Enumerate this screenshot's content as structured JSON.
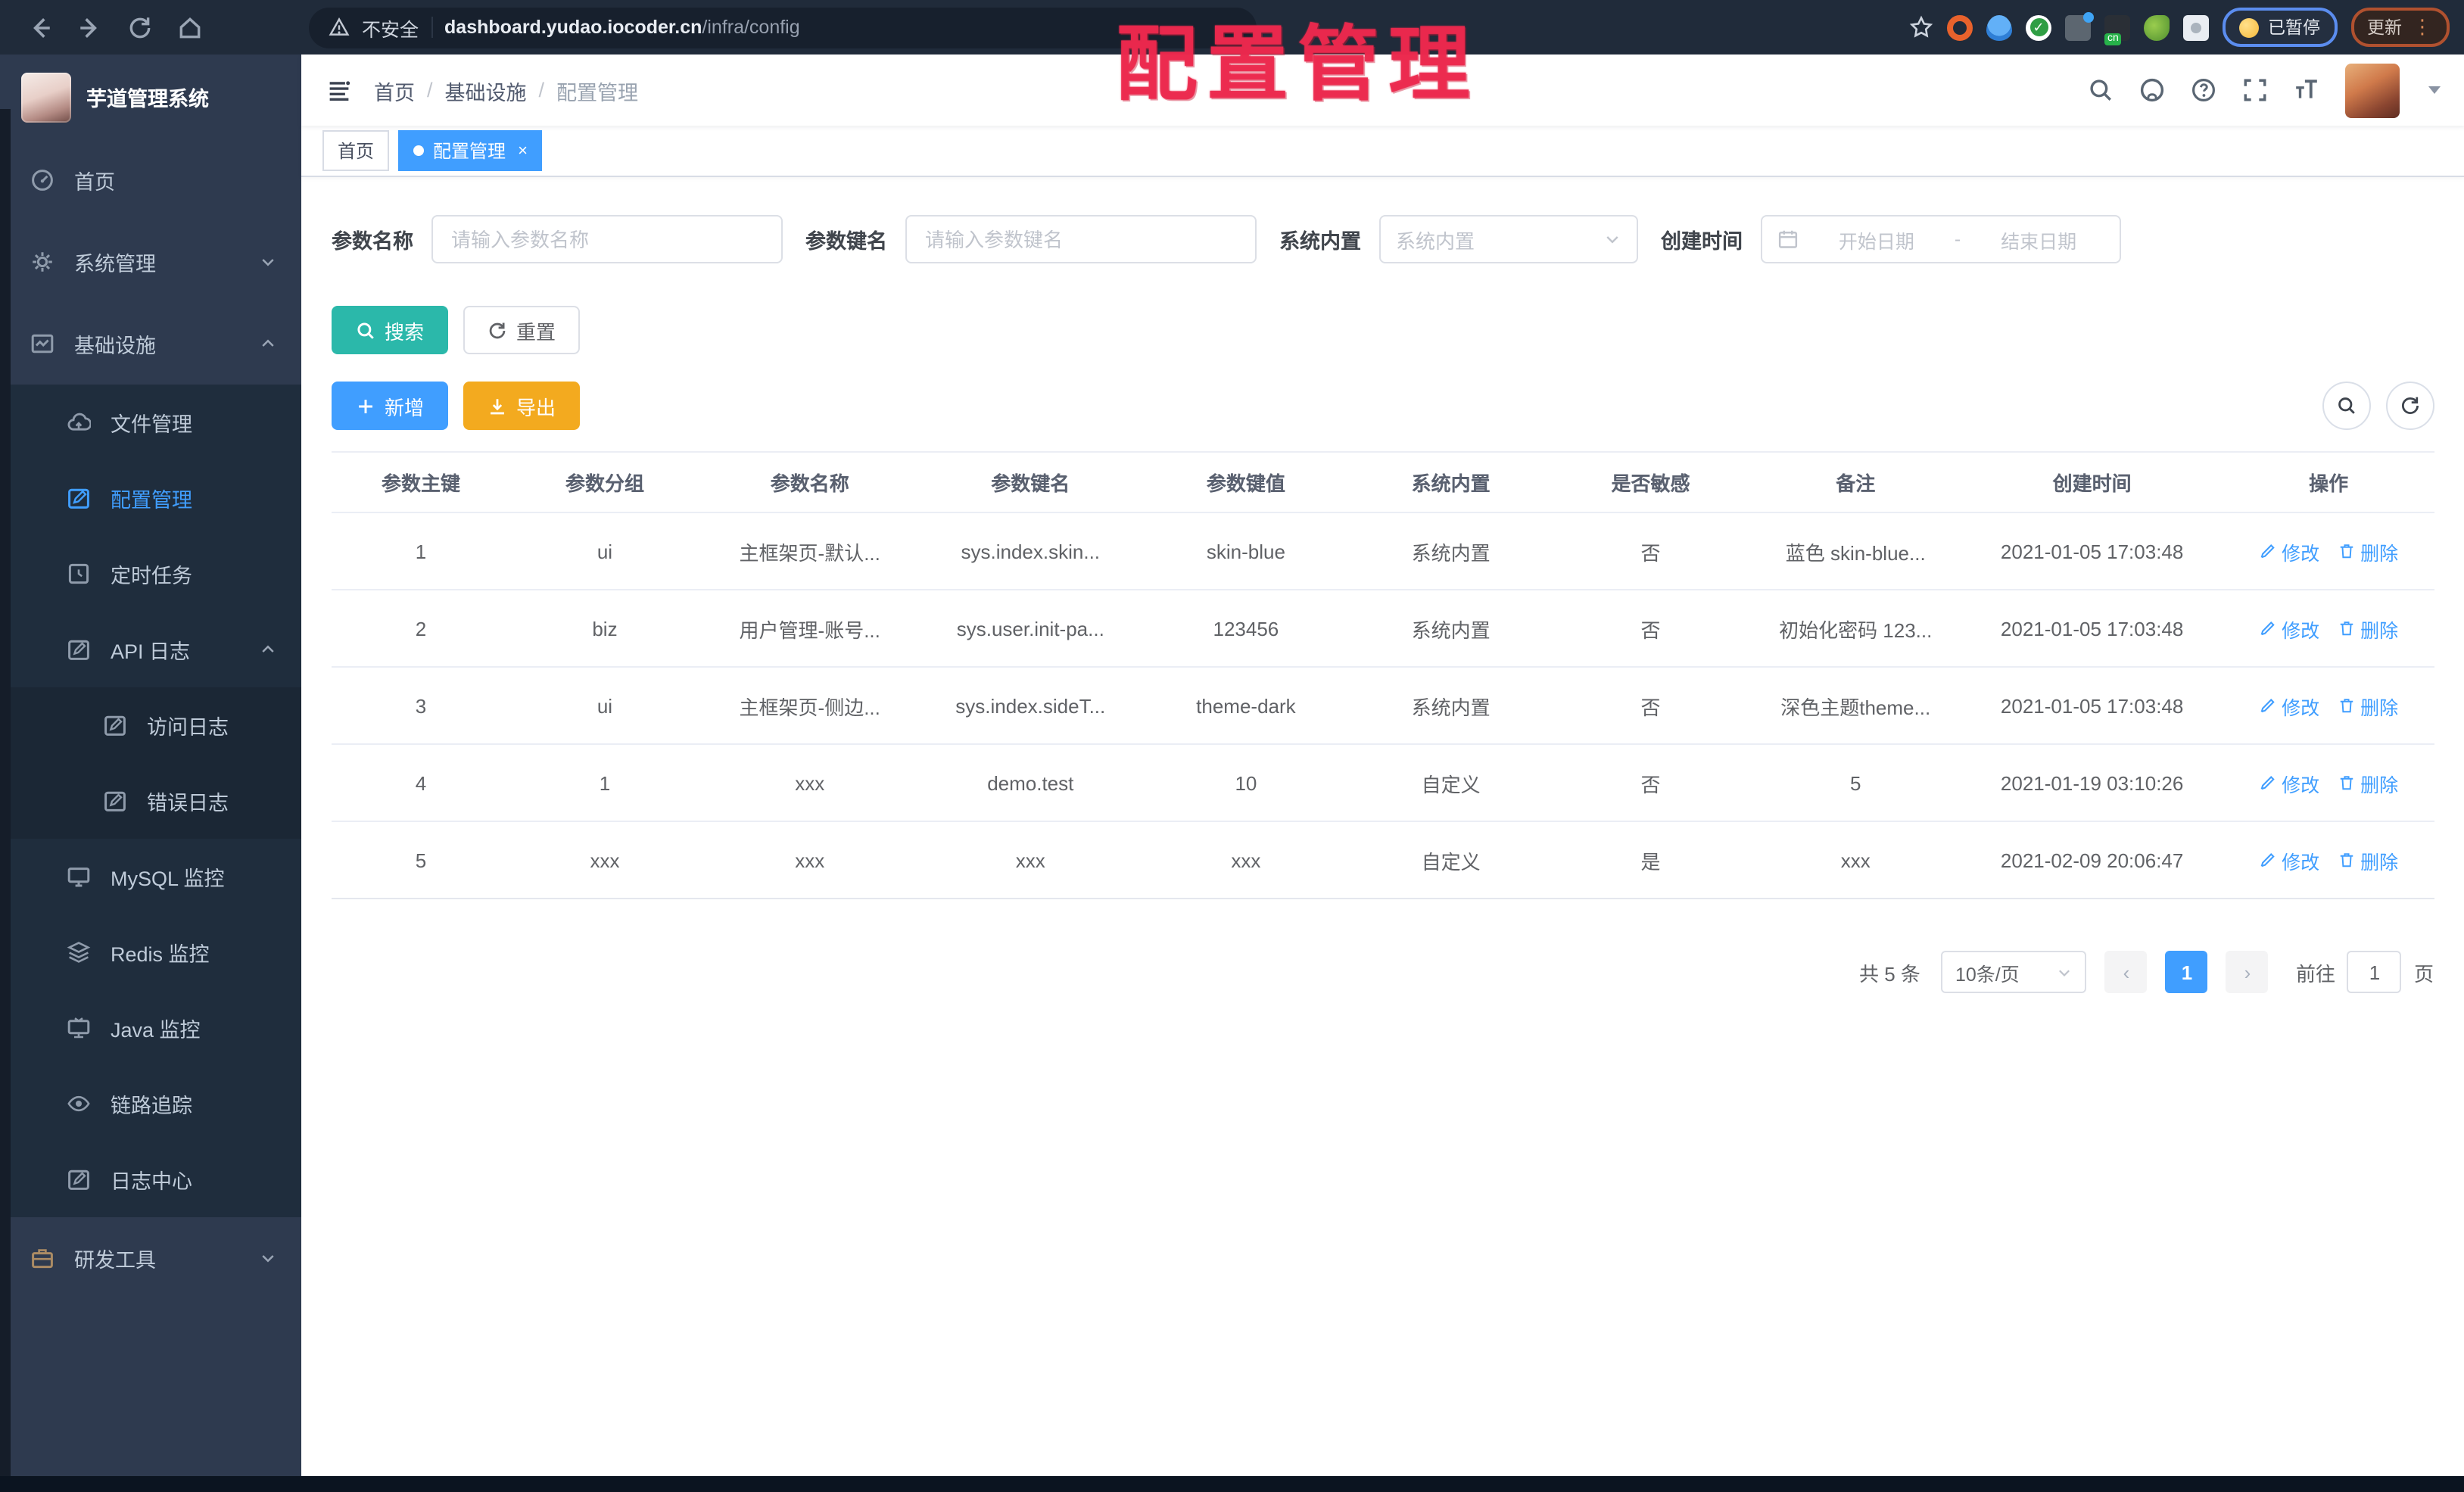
{
  "browser": {
    "security_label": "不安全",
    "url_host": "dashboard.yudao.iocoder.cn",
    "url_path": "/infra/config",
    "paused_badge": "已暂停",
    "update_button": "更新"
  },
  "watermark": "配置管理",
  "sidebar": {
    "title": "芋道管理系统",
    "items": [
      {
        "label": "首页",
        "icon": "dashboard",
        "level": 1
      },
      {
        "label": "系统管理",
        "icon": "gear",
        "level": 1,
        "arrow": "down"
      },
      {
        "label": "基础设施",
        "icon": "infra",
        "level": 1,
        "arrow": "up"
      },
      {
        "label": "文件管理",
        "icon": "cloud",
        "level": 2
      },
      {
        "label": "配置管理",
        "icon": "edit",
        "level": 2,
        "active": true
      },
      {
        "label": "定时任务",
        "icon": "timer",
        "level": 2
      },
      {
        "label": "API 日志",
        "icon": "log",
        "level": 2,
        "arrow": "up"
      },
      {
        "label": "访问日志",
        "icon": "log",
        "level": 3
      },
      {
        "label": "错误日志",
        "icon": "log",
        "level": 3
      },
      {
        "label": "MySQL 监控",
        "icon": "monitor",
        "level": 2
      },
      {
        "label": "Redis 监控",
        "icon": "layers",
        "level": 2
      },
      {
        "label": "Java 监控",
        "icon": "tv",
        "level": 2
      },
      {
        "label": "链路追踪",
        "icon": "eye",
        "level": 2
      },
      {
        "label": "日志中心",
        "icon": "log",
        "level": 2
      },
      {
        "label": "研发工具",
        "icon": "briefcase",
        "level": 1,
        "arrow": "down"
      }
    ]
  },
  "header": {
    "breadcrumb": [
      "首页",
      "基础设施",
      "配置管理"
    ]
  },
  "tabs": [
    {
      "label": "首页",
      "active": false
    },
    {
      "label": "配置管理",
      "active": true,
      "closable": true
    }
  ],
  "filters": {
    "name": {
      "label": "参数名称",
      "placeholder": "请输入参数名称"
    },
    "key": {
      "label": "参数键名",
      "placeholder": "请输入参数键名"
    },
    "builtin": {
      "label": "系统内置",
      "placeholder": "系统内置"
    },
    "time": {
      "label": "创建时间",
      "start": "开始日期",
      "separator": "-",
      "end": "结束日期"
    }
  },
  "buttons": {
    "search": "搜索",
    "reset": "重置",
    "add": "新增",
    "export": "导出"
  },
  "table": {
    "columns": [
      "参数主键",
      "参数分组",
      "参数名称",
      "参数键名",
      "参数键值",
      "系统内置",
      "是否敏感",
      "备注",
      "创建时间",
      "操作"
    ],
    "rows": [
      [
        "1",
        "ui",
        "主框架页-默认...",
        "sys.index.skin...",
        "skin-blue",
        "系统内置",
        "否",
        "蓝色 skin-blue...",
        "2021-01-05 17:03:48"
      ],
      [
        "2",
        "biz",
        "用户管理-账号...",
        "sys.user.init-pa...",
        "123456",
        "系统内置",
        "否",
        "初始化密码 123...",
        "2021-01-05 17:03:48"
      ],
      [
        "3",
        "ui",
        "主框架页-侧边...",
        "sys.index.sideT...",
        "theme-dark",
        "系统内置",
        "否",
        "深色主题theme...",
        "2021-01-05 17:03:48"
      ],
      [
        "4",
        "1",
        "xxx",
        "demo.test",
        "10",
        "自定义",
        "否",
        "5",
        "2021-01-19 03:10:26"
      ],
      [
        "5",
        "xxx",
        "xxx",
        "xxx",
        "xxx",
        "自定义",
        "是",
        "xxx",
        "2021-02-09 20:06:47"
      ]
    ],
    "edit_label": "修改",
    "delete_label": "删除"
  },
  "pagination": {
    "total_text": "共 5 条",
    "page_size": "10条/页",
    "current_page": "1",
    "goto_label": "前往",
    "goto_value": "1",
    "goto_unit": "页"
  },
  "colors": {
    "accent": "#409eff",
    "search_button": "#2bb8aa",
    "export_button": "#f3aa1f",
    "sidebar_bg": "#2e3a4f",
    "submenu_bg": "#1f2d3d",
    "browser_bar_bg": "#202b3a",
    "watermark_red": "#ec294d"
  }
}
